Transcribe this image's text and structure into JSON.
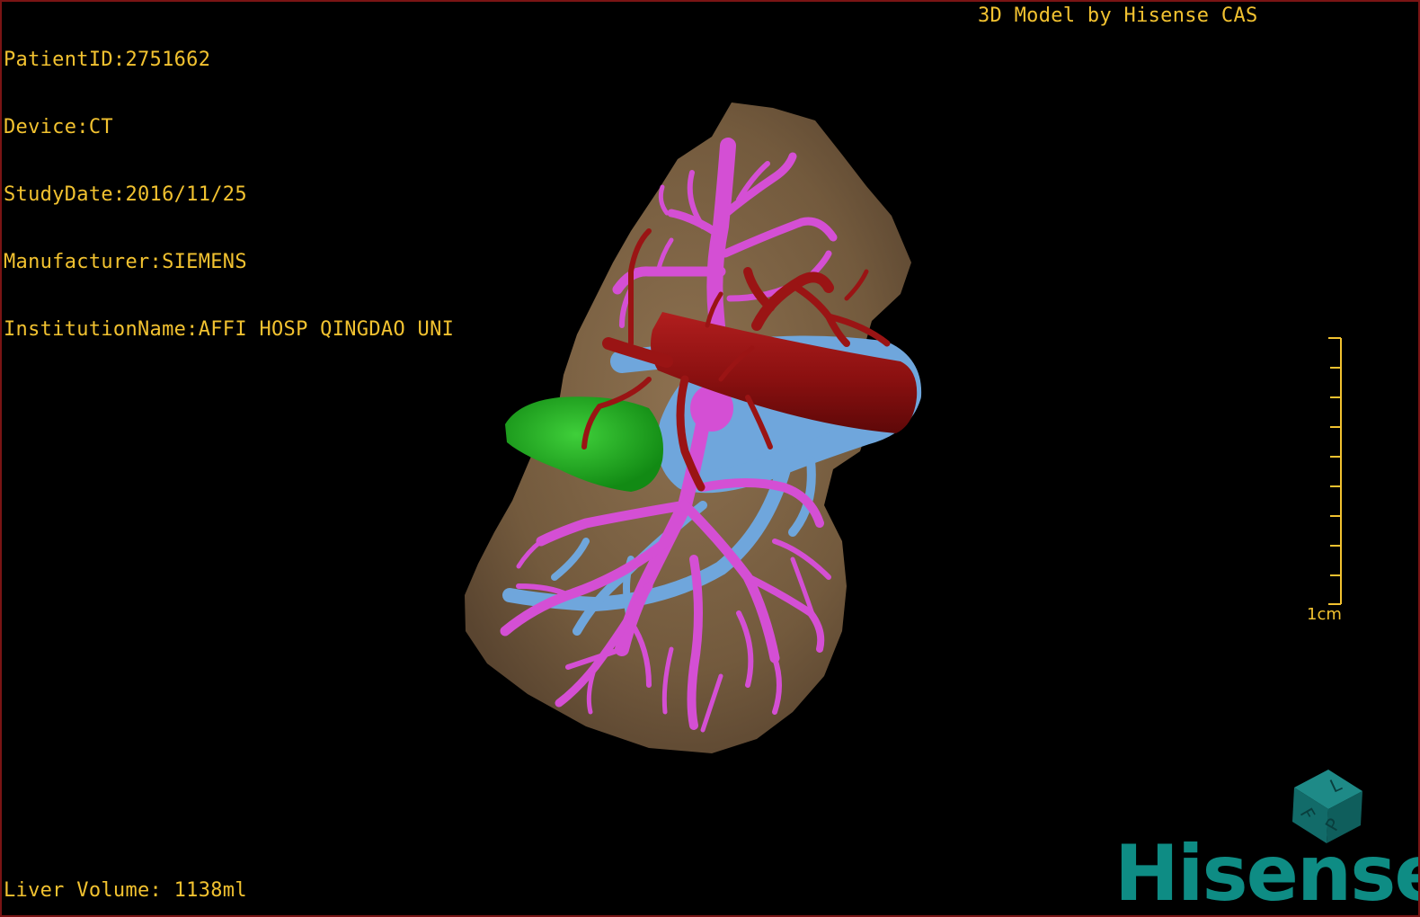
{
  "patient_info": {
    "patient_id": "PatientID:2751662",
    "device": "Device:CT",
    "study_date": "StudyDate:2016/11/25",
    "manufacturer": "Manufacturer:SIEMENS",
    "institution": "InstitutionName:AFFI HOSP QINGDAO UNI"
  },
  "model_credit": "3D Model by Hisense CAS",
  "liver_volume": "Liver Volume: 1138ml",
  "scale_bar": {
    "label": "1cm"
  },
  "orientation_cube": {
    "faces": [
      "F",
      "L",
      "P"
    ]
  },
  "brand_logo": "Hisense",
  "colors": {
    "overlay_text": "#f2c230",
    "liver": "#7d6446",
    "portal_vein": "#d44fd4",
    "hepatic_artery": "#9a1414",
    "hepatic_vein": "#6fa6dc",
    "gallbladder": "#1fa820",
    "brand": "#0e8c84"
  },
  "icons": [
    "orientation-cube-icon",
    "scale-bar-icon"
  ]
}
